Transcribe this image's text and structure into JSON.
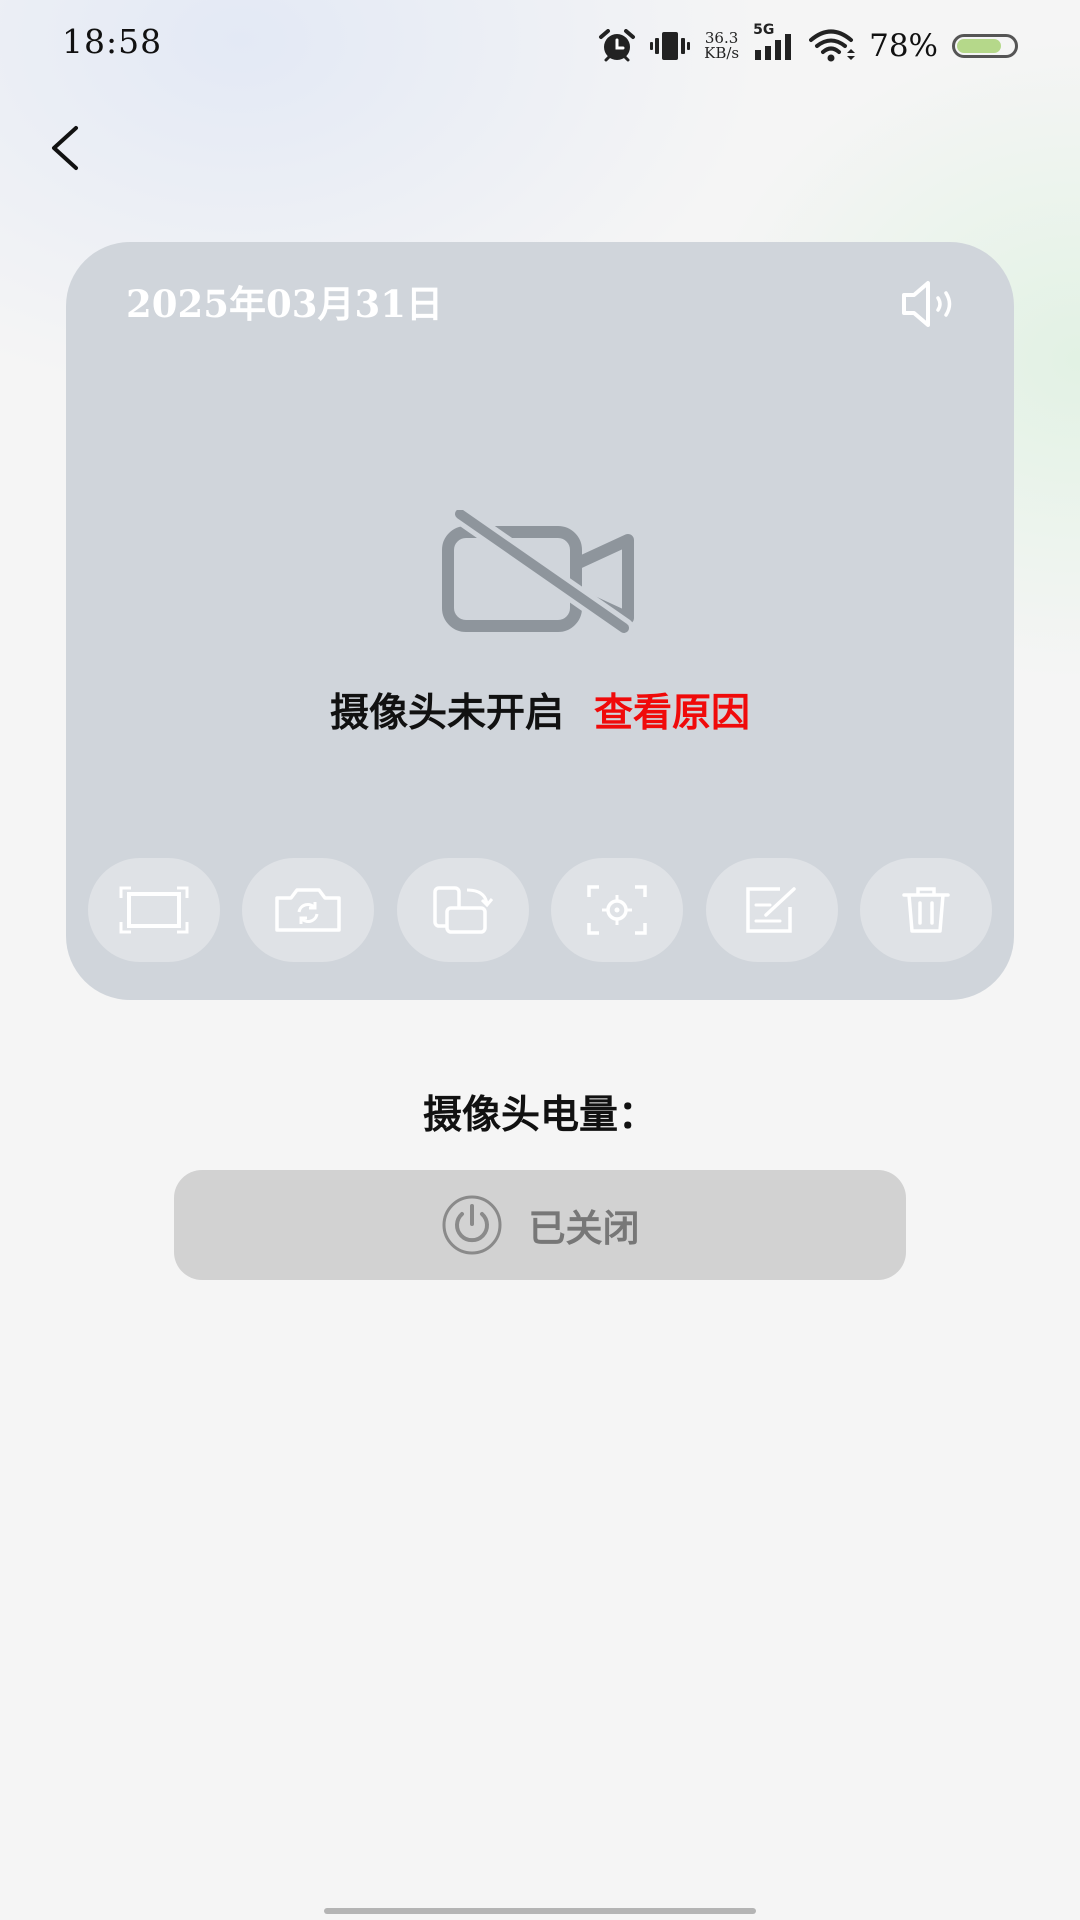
{
  "status_bar": {
    "time": "18:58",
    "net_speed_value": "36.3",
    "net_speed_unit": "KB/s",
    "network_type": "5G",
    "battery_percent": "78%",
    "battery_level": 0.78,
    "icons": [
      "alarm-icon",
      "vibrate-icon",
      "signal-icon",
      "wifi-icon",
      "battery-icon"
    ]
  },
  "nav": {
    "back_icon": "chevron-left-icon"
  },
  "camera_card": {
    "date": "2025年03月31日",
    "speaker_icon": "speaker-icon",
    "status_icon": "camera-off-icon",
    "status_text": "摄像头未开启",
    "reason_link": "查看原因",
    "tools": [
      {
        "name": "fullscreen",
        "icon": "fullscreen-icon"
      },
      {
        "name": "flip-camera",
        "icon": "camera-flip-icon"
      },
      {
        "name": "rotate",
        "icon": "rotate-screen-icon"
      },
      {
        "name": "focus",
        "icon": "focus-target-icon"
      },
      {
        "name": "edit",
        "icon": "edit-icon"
      },
      {
        "name": "delete",
        "icon": "trash-icon"
      }
    ]
  },
  "battery_section": {
    "label": "摄像头电量："
  },
  "power_button": {
    "label": "已关闭",
    "icon": "power-icon"
  },
  "colors": {
    "card_bg": "#d0d5db",
    "tool_bg": "#dfe2e6",
    "reason_red": "#f00a0a",
    "power_bg": "#d2d2d2",
    "power_text": "#777777",
    "battery_fill": "#b5d88a"
  }
}
